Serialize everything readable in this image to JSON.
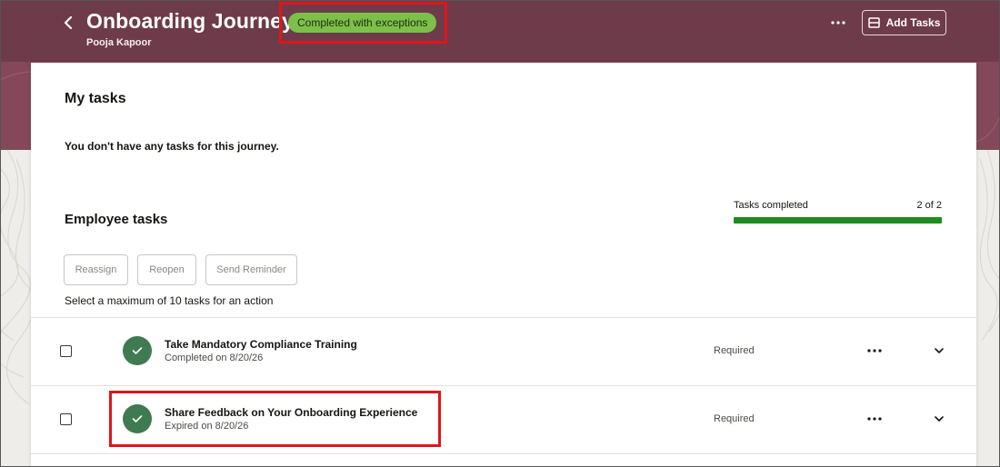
{
  "header": {
    "title": "Onboarding Journey",
    "subtitle": "Pooja Kapoor",
    "status_badge": "Completed with exceptions",
    "add_tasks_label": "Add Tasks"
  },
  "my_tasks": {
    "heading": "My tasks",
    "empty_message": "You don't have any tasks for this journey."
  },
  "employee_tasks": {
    "heading": "Employee tasks",
    "progress": {
      "label": "Tasks completed",
      "count_text": "2 of 2",
      "completed": 2,
      "total": 2
    },
    "actions": {
      "reassign": "Reassign",
      "reopen": "Reopen",
      "send_reminder": "Send Reminder"
    },
    "helper_text": "Select a maximum of 10 tasks for an action",
    "tasks": [
      {
        "title": "Take Mandatory Compliance Training",
        "status": "Completed",
        "date_text": "on 8/20/26",
        "requirement": "Required"
      },
      {
        "title": "Share Feedback on Your Onboarding Experience",
        "status": "Expired",
        "date_text": "on 8/20/26",
        "requirement": "Required"
      }
    ]
  },
  "colors": {
    "header_bg": "#6e3b4a",
    "badge_bg": "#7cc04a",
    "progress_fill": "#1f8c1f",
    "check_circle": "#3f7a51",
    "highlight": "#e0151b"
  },
  "icons": {
    "back": "chevron-left-icon",
    "more": "more-horizontal-icon",
    "add_tasks": "add-tasks-icon",
    "task_done": "checkmark-icon",
    "expand": "chevron-down-icon"
  }
}
